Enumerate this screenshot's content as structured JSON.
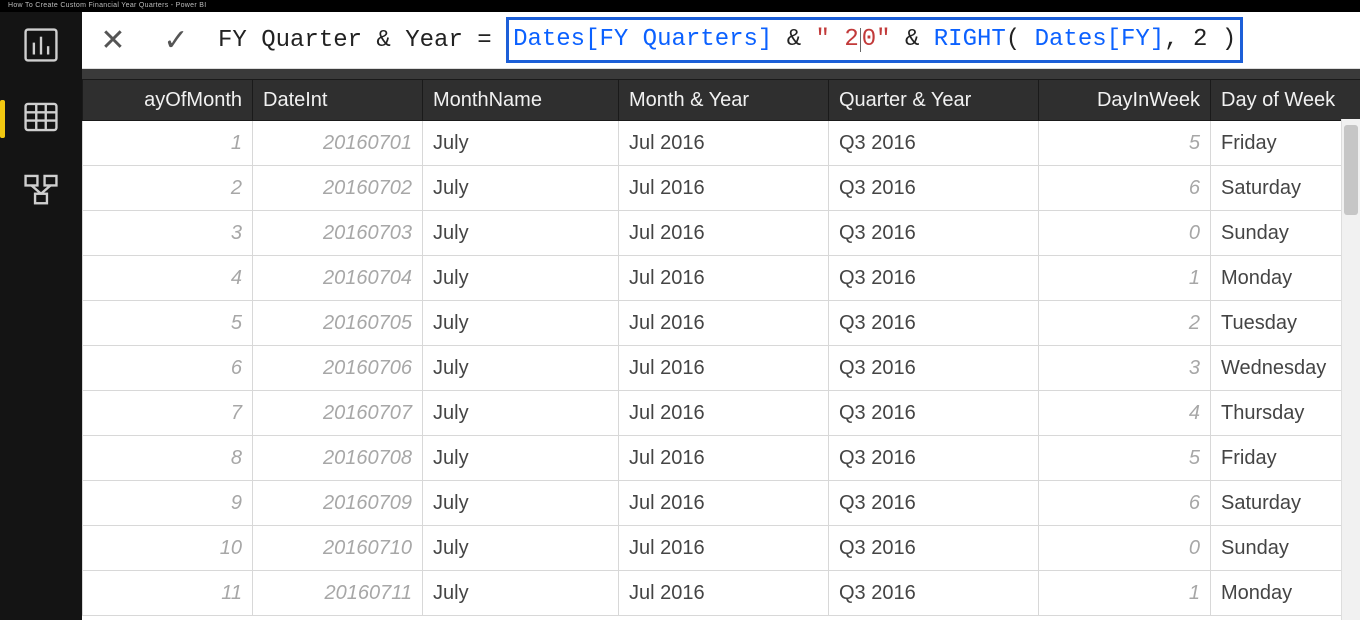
{
  "video_title": "How To Create Custom Financial Year Quarters - Power BI",
  "nav": {
    "items": [
      {
        "name": "report-view-icon"
      },
      {
        "name": "data-view-icon"
      },
      {
        "name": "model-view-icon"
      }
    ],
    "active_index": 1
  },
  "formula_bar": {
    "measure_name": "FY Quarter & Year",
    "equals": " = ",
    "tokens": {
      "ref1": "Dates[FY Quarters]",
      "amp1": " & ",
      "str_open": "\" 2",
      "str_rest": "0\"",
      "amp2": " & ",
      "fn": "RIGHT",
      "fn_rest_open": "( ",
      "ref2": "Dates[FY]",
      "fn_rest_close": ", 2 )"
    }
  },
  "table": {
    "columns": [
      {
        "key": "dom",
        "label": "ayOfMonth",
        "align": "right"
      },
      {
        "key": "dint",
        "label": "DateInt",
        "align": "left"
      },
      {
        "key": "mname",
        "label": "MonthName",
        "align": "left"
      },
      {
        "key": "my",
        "label": "Month & Year",
        "align": "left"
      },
      {
        "key": "qy",
        "label": "Quarter & Year",
        "align": "left"
      },
      {
        "key": "diw",
        "label": "DayInWeek",
        "align": "right"
      },
      {
        "key": "dow",
        "label": "Day of Week",
        "align": "left"
      }
    ],
    "rows": [
      {
        "dom": "1",
        "dint": "20160701",
        "mname": "July",
        "my": "Jul 2016",
        "qy": "Q3 2016",
        "diw": "5",
        "dow": "Friday"
      },
      {
        "dom": "2",
        "dint": "20160702",
        "mname": "July",
        "my": "Jul 2016",
        "qy": "Q3 2016",
        "diw": "6",
        "dow": "Saturday"
      },
      {
        "dom": "3",
        "dint": "20160703",
        "mname": "July",
        "my": "Jul 2016",
        "qy": "Q3 2016",
        "diw": "0",
        "dow": "Sunday"
      },
      {
        "dom": "4",
        "dint": "20160704",
        "mname": "July",
        "my": "Jul 2016",
        "qy": "Q3 2016",
        "diw": "1",
        "dow": "Monday"
      },
      {
        "dom": "5",
        "dint": "20160705",
        "mname": "July",
        "my": "Jul 2016",
        "qy": "Q3 2016",
        "diw": "2",
        "dow": "Tuesday"
      },
      {
        "dom": "6",
        "dint": "20160706",
        "mname": "July",
        "my": "Jul 2016",
        "qy": "Q3 2016",
        "diw": "3",
        "dow": "Wednesday"
      },
      {
        "dom": "7",
        "dint": "20160707",
        "mname": "July",
        "my": "Jul 2016",
        "qy": "Q3 2016",
        "diw": "4",
        "dow": "Thursday"
      },
      {
        "dom": "8",
        "dint": "20160708",
        "mname": "July",
        "my": "Jul 2016",
        "qy": "Q3 2016",
        "diw": "5",
        "dow": "Friday"
      },
      {
        "dom": "9",
        "dint": "20160709",
        "mname": "July",
        "my": "Jul 2016",
        "qy": "Q3 2016",
        "diw": "6",
        "dow": "Saturday"
      },
      {
        "dom": "10",
        "dint": "20160710",
        "mname": "July",
        "my": "Jul 2016",
        "qy": "Q3 2016",
        "diw": "0",
        "dow": "Sunday"
      },
      {
        "dom": "11",
        "dint": "20160711",
        "mname": "July",
        "my": "Jul 2016",
        "qy": "Q3 2016",
        "diw": "1",
        "dow": "Monday"
      }
    ]
  }
}
